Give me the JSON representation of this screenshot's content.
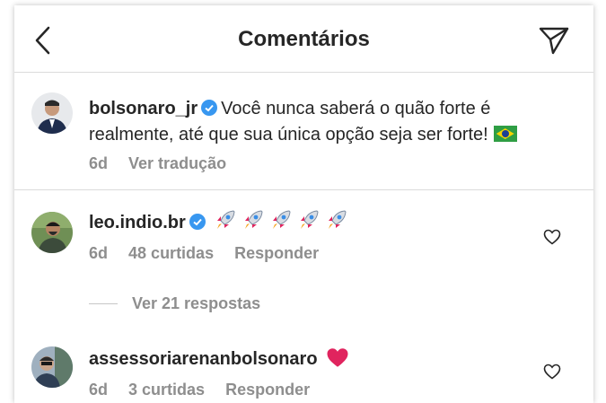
{
  "header": {
    "title": "Comentários",
    "back_icon": "chevron-left-icon",
    "share_icon": "paper-plane-icon"
  },
  "caption": {
    "username": "bolsonaro_jr",
    "verified": true,
    "text": "Você nunca saberá o quão forte é realmente, até que sua única opção seja ser forte!",
    "emoji": "brazil-flag",
    "time": "6d",
    "translate_label": "Ver tradução"
  },
  "comments": [
    {
      "username": "leo.indio.br",
      "verified": true,
      "text_emoji": "rocket x5",
      "time": "6d",
      "likes": "48 curtidas",
      "reply_label": "Responder",
      "view_replies": "Ver 21 respostas"
    },
    {
      "username": "assessoriarenanbolsonaro",
      "verified": false,
      "text_emoji": "red heart",
      "time": "6d",
      "likes": "3 curtidas",
      "reply_label": "Responder"
    }
  ],
  "colors": {
    "text": "#262626",
    "muted": "#8e8e8e",
    "divider": "#dbdbdb",
    "verified": "#3897f0",
    "heart": "#e0245e"
  }
}
